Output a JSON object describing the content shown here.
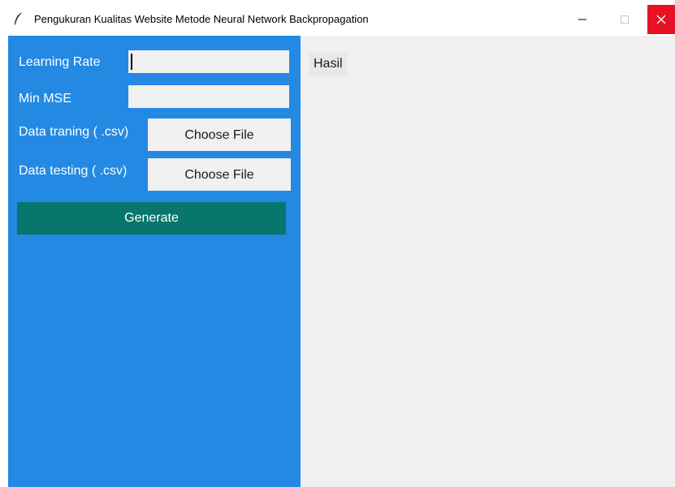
{
  "window": {
    "title": "Pengukuran Kualitas Website Metode Neural Network Backpropagation",
    "icon": "feather-icon",
    "controls": {
      "minimize": "minimize-icon",
      "maximize": "maximize-icon",
      "close": "close-icon"
    }
  },
  "form": {
    "learning_rate_label": "Learning Rate",
    "learning_rate_value": "",
    "min_mse_label": "Min MSE",
    "min_mse_value": "",
    "data_training_label": "Data traning ( .csv)",
    "data_training_button": "Choose File",
    "data_testing_label": "Data testing ( .csv)",
    "data_testing_button": "Choose File",
    "generate_button": "Generate"
  },
  "result": {
    "label": "Hasil"
  },
  "colors": {
    "left_panel": "#2489e3",
    "generate_button": "#08766d",
    "close_button": "#e81123",
    "right_panel": "#f0f0f0"
  }
}
